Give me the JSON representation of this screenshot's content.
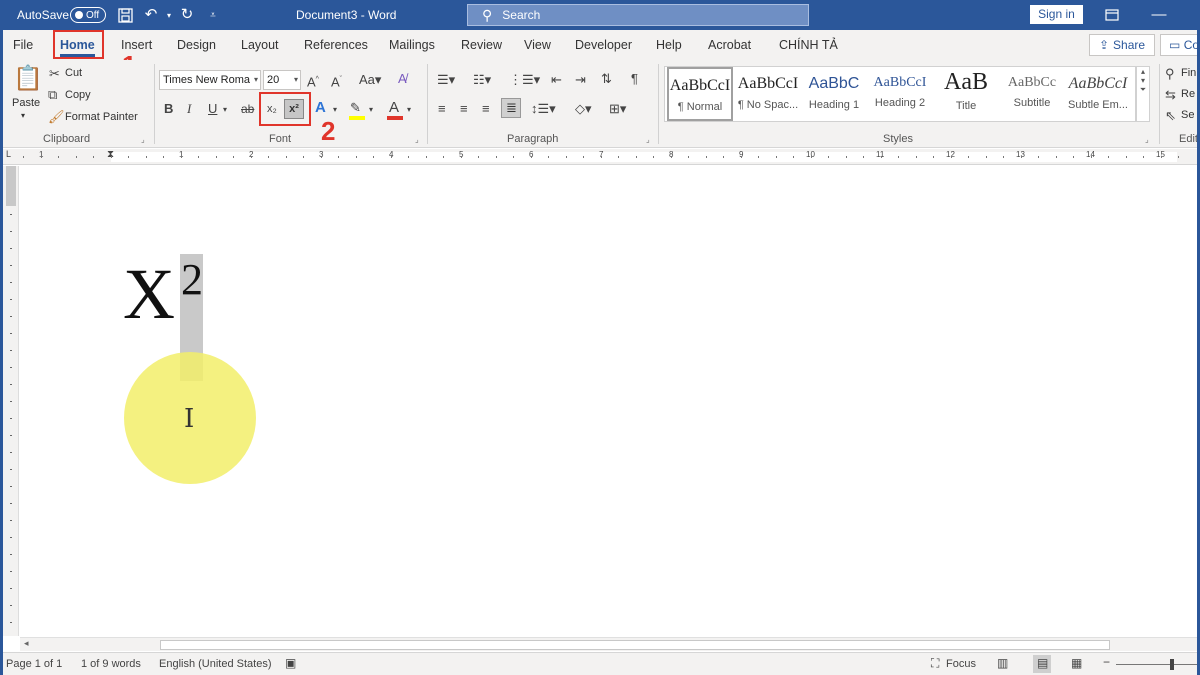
{
  "title_bar": {
    "autosave_label": "AutoSave",
    "autosave_state": "Off",
    "doc_title": "Document3 - Word",
    "search_placeholder": "Search",
    "signin_label": "Sign in"
  },
  "tabs": [
    "File",
    "Home",
    "Insert",
    "Design",
    "Layout",
    "References",
    "Mailings",
    "Review",
    "View",
    "Developer",
    "Help",
    "Acrobat",
    "CHÍNH TẢ"
  ],
  "share_label": "Share",
  "comments_label": "Co",
  "annotations": {
    "step1": "1",
    "step2": "2",
    "color": "#e0352b"
  },
  "clipboard": {
    "paste": "Paste",
    "cut": "Cut",
    "copy": "Copy",
    "format_painter": "Format Painter",
    "label": "Clipboard"
  },
  "font": {
    "family": "Times New Roma",
    "size": "20",
    "bold": "B",
    "italic": "I",
    "underline": "U",
    "strike": "ab",
    "subscript": "x₂",
    "superscript": "x²",
    "label": "Font"
  },
  "paragraph": {
    "label": "Paragraph"
  },
  "styles": {
    "items": [
      {
        "preview": "AaBbCcI",
        "name": "¶ Normal"
      },
      {
        "preview": "AaBbCcI",
        "name": "¶ No Spac..."
      },
      {
        "preview": "AaBbC",
        "name": "Heading 1"
      },
      {
        "preview": "AaBbCcI",
        "name": "Heading 2"
      },
      {
        "preview": "AaB",
        "name": "Title"
      },
      {
        "preview": "AaBbCc",
        "name": "Subtitle"
      },
      {
        "preview": "AaBbCcI",
        "name": "Subtle Em..."
      }
    ],
    "label": "Styles"
  },
  "editing": {
    "find": "Fin",
    "replace": "Re",
    "select": "Se",
    "label": "Edit"
  },
  "ruler_numbers": [
    "1",
    "1",
    "2",
    "3",
    "4",
    "5",
    "6",
    "7",
    "8",
    "9",
    "10",
    "11",
    "12",
    "13",
    "14",
    "15"
  ],
  "document": {
    "base": "X",
    "superscript": "2"
  },
  "status": {
    "page": "Page 1 of 1",
    "words": "1 of 9 words",
    "language": "English (United States)",
    "focus": "Focus"
  }
}
